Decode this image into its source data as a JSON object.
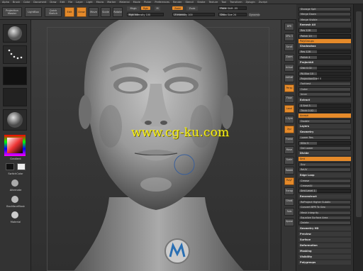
{
  "menubar": [
    "Alpha",
    "Brush",
    "Color",
    "Document",
    "Draw",
    "Edit",
    "File",
    "Layer",
    "Light",
    "Macro",
    "Marker",
    "Material",
    "Movie",
    "Picker",
    "Preferences",
    "Render",
    "Stencil",
    "Stroke",
    "Texture",
    "Tool",
    "Transform",
    "Zplugin",
    "Zscript"
  ],
  "shelf": {
    "projection_master": "Projection Master",
    "lightbox": "LightBox",
    "quick_sketch": "Quick Sketch",
    "edit": "Edit",
    "draw": "Draw",
    "move": "Move",
    "scale": "Scale",
    "rotate": "Rotate",
    "mrgb": "Mrgb",
    "rgb": "Rgb",
    "m": "M",
    "rgb_intensity": "Rgb Intensity 100",
    "zadd": "Zadd",
    "zsub": "Zsub",
    "z_intensity": "Z Intensity 100",
    "focal_shift": "Focal Shift -55",
    "draw_size": "Draw Size 24",
    "dynamic": "Dynamic"
  },
  "left_tray": {
    "alpha_label": "",
    "gradient": "Gradient",
    "switch_color": "SwitchColor",
    "alternate": "Alternate",
    "backfaces": "BackfaceMask",
    "matcap": "Material"
  },
  "right_tools": [
    "BPR",
    "SPix 3",
    "Scroll",
    "Zoom",
    "Actual",
    "AAHalf",
    "Persp",
    "Floor",
    "Local",
    "L.Sym",
    "Xyz",
    "Frame",
    "Move",
    "Scale",
    "Rotate",
    "PolyF",
    "Transp",
    "Ghost",
    "Solo",
    "Xpose"
  ],
  "palette": {
    "rows": [
      {
        "t": "Storage Spit",
        "k": "btn"
      },
      {
        "t": "Merge Down",
        "k": "btn"
      },
      {
        "t": "Merge Visible",
        "k": "btn"
      },
      {
        "t": "Remesh All",
        "k": "hdr"
      },
      {
        "t": "Res 128",
        "k": "sl"
      },
      {
        "t": "Polish 10",
        "k": "sl"
      },
      {
        "t": "PolyGroups",
        "k": "orange"
      },
      {
        "t": "Shadowbox",
        "k": "hdr"
      },
      {
        "t": "Res 128",
        "k": "sl"
      },
      {
        "t": "Polish 4",
        "k": "sl"
      },
      {
        "t": "ProjectAll",
        "k": "hdr"
      },
      {
        "t": "Dist 0.02",
        "k": "sl"
      },
      {
        "t": "PA Blur 10",
        "k": "sl"
      },
      {
        "t": "ProjectionShell 0",
        "k": "sl"
      },
      {
        "t": "Farthest",
        "k": "btn"
      },
      {
        "t": "Outer",
        "k": "btn"
      },
      {
        "t": "Inner",
        "k": "btn"
      },
      {
        "t": "Extract",
        "k": "hdr"
      },
      {
        "t": "S Smt 5",
        "k": "sl"
      },
      {
        "t": "Thick 0.02",
        "k": "sl"
      },
      {
        "t": "Accept",
        "k": "orange"
      },
      {
        "t": "Double",
        "k": "btn"
      },
      {
        "t": "Layers",
        "k": "hdr"
      },
      {
        "t": "Geometry",
        "k": "hdr"
      },
      {
        "t": "Lower Res",
        "k": "btn"
      },
      {
        "t": "SDiv 5",
        "k": "sl"
      },
      {
        "t": "Del Lower",
        "k": "btn"
      },
      {
        "t": "Divide",
        "k": "hdr"
      },
      {
        "t": "Smt",
        "k": "orange"
      },
      {
        "t": "Suv",
        "k": "btn"
      },
      {
        "t": "ReUV",
        "k": "btn"
      },
      {
        "t": "Edge Loop",
        "k": "hdr"
      },
      {
        "t": "Crease",
        "k": "btn"
      },
      {
        "t": "CreaseAll",
        "k": "btn"
      },
      {
        "t": "Smt Level 1",
        "k": "sl"
      },
      {
        "t": "Reconstruct",
        "k": "hdr"
      },
      {
        "t": "ReProject Higher Subdiv",
        "k": "btn"
      },
      {
        "t": "Convert BPR To Geo",
        "k": "btn"
      },
      {
        "t": "Mesh Integrity",
        "k": "btn"
      },
      {
        "t": "Equalize Surface Area",
        "k": "btn"
      },
      {
        "t": "Delete",
        "k": "btn"
      },
      {
        "t": "Geometry HD",
        "k": "hdr"
      },
      {
        "t": "Preview",
        "k": "hdr"
      },
      {
        "t": "Surface",
        "k": "hdr"
      },
      {
        "t": "Deformation",
        "k": "hdr"
      },
      {
        "t": "Masking",
        "k": "hdr"
      },
      {
        "t": "Visibility",
        "k": "hdr"
      },
      {
        "t": "Polygroups",
        "k": "hdr"
      }
    ]
  },
  "watermark": "www.cg-ku.com",
  "colors": {
    "accent": "#e58a2a",
    "ui_bg": "#2f2f2f",
    "clay": "#9a9a9a"
  }
}
